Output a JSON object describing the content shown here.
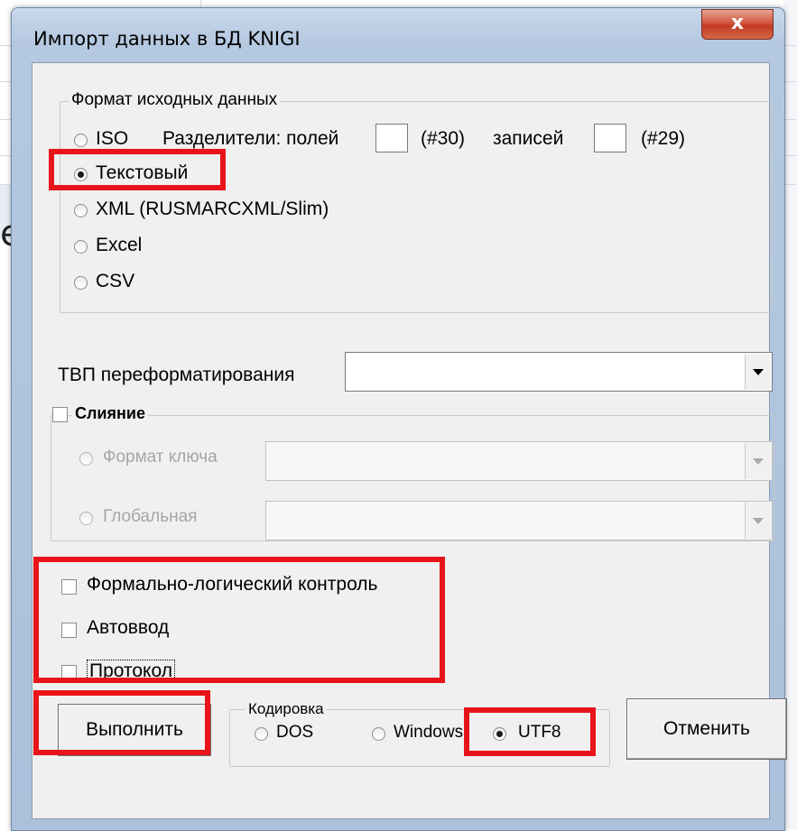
{
  "window": {
    "title": "Импорт данных в БД KNIGI",
    "close_symbol": "x"
  },
  "background": {
    "letter": "e"
  },
  "source_format": {
    "group_label": "Формат исходных данных",
    "options": [
      {
        "label": "ISO",
        "checked": false
      },
      {
        "label": "Текстовый",
        "checked": true
      },
      {
        "label": "XML (RUSMARCXML/Slim)",
        "checked": false
      },
      {
        "label": "Excel",
        "checked": false
      },
      {
        "label": "CSV",
        "checked": false
      }
    ],
    "separators_label": "Разделители: полей",
    "field_sep_value": "",
    "field_sep_code": "(#30)",
    "records_label": "записей",
    "record_sep_value": "",
    "record_sep_code": "(#29)"
  },
  "reformat": {
    "label": "ТВП переформатирования",
    "value": ""
  },
  "merge": {
    "label": "Слияние",
    "checked": false,
    "key_format_label": "Формат ключа",
    "global_label": "Глобальная",
    "key_format_value": "",
    "global_value": ""
  },
  "options": {
    "formal_logic_label": "Формально-логический контроль",
    "autoinput_label": "Автоввод",
    "protocol_label": "Протокол"
  },
  "encoding": {
    "group_label": "Кодировка",
    "dos_label": "DOS",
    "windows_label": "Windows",
    "utf8_label": "UTF8",
    "selected": "UTF8"
  },
  "buttons": {
    "execute_label": "Выполнить",
    "cancel_label": "Отменить"
  },
  "colors": {
    "highlight": "#e8141a",
    "title_bar": "#b4c8e0",
    "close_button": "#c23a22"
  }
}
